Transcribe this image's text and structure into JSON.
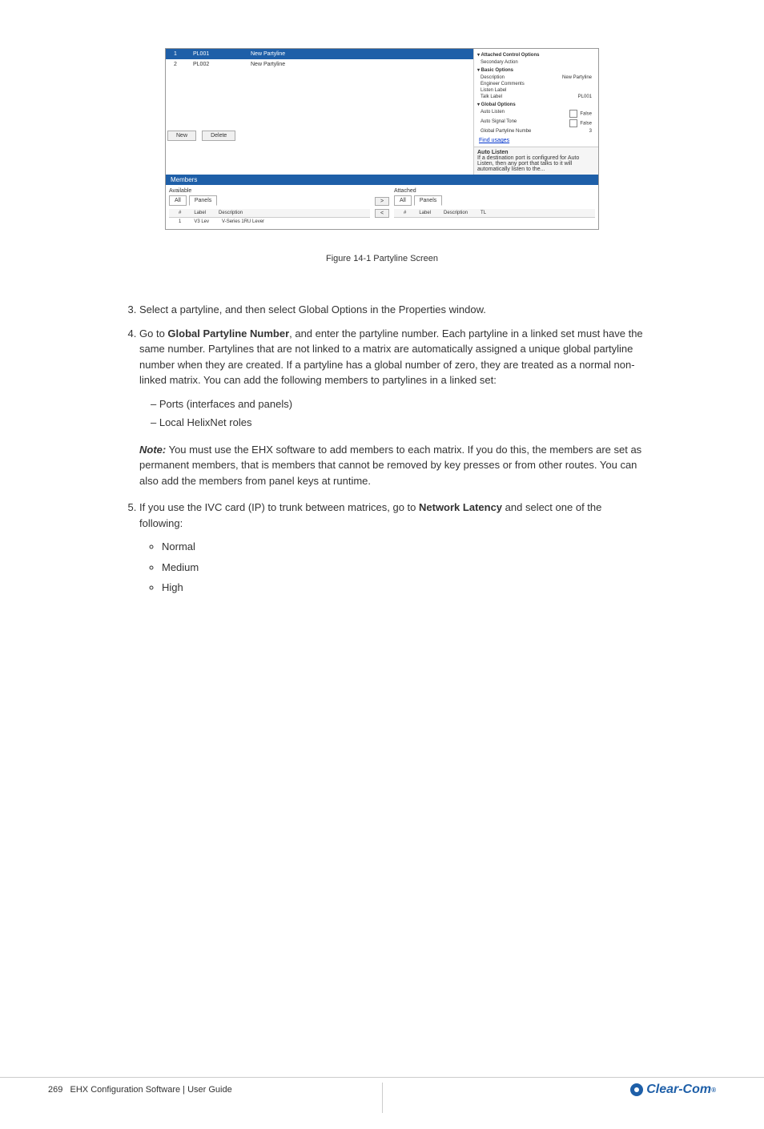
{
  "screenshot": {
    "grid": {
      "rows": [
        {
          "n": "1",
          "label": "PL001",
          "desc": "New Partyline",
          "selected": true
        },
        {
          "n": "2",
          "label": "PL002",
          "desc": "New Partyline",
          "selected": false
        }
      ],
      "btn_new": "New",
      "btn_delete": "Delete"
    },
    "props": {
      "groups": [
        {
          "name": "Attached Control Options",
          "items": [
            {
              "k": "Secondary Action",
              "v": ""
            }
          ]
        },
        {
          "name": "Basic Options",
          "items": [
            {
              "k": "Description",
              "v": "New Partyline"
            },
            {
              "k": "Engineer Comments",
              "v": ""
            },
            {
              "k": "Listen Label",
              "v": ""
            },
            {
              "k": "Talk Label",
              "v": "PL001"
            }
          ]
        },
        {
          "name": "Global Options",
          "items": [
            {
              "k": "Auto Listen",
              "v": "False",
              "cb": true
            },
            {
              "k": "Auto Signal Tone",
              "v": "False",
              "cb": true
            },
            {
              "k": "Global Partyline Numbe",
              "v": "3"
            }
          ]
        }
      ],
      "link": "Find usages",
      "help_title": "Auto Listen",
      "help_text": "If a destination port is configured for Auto Listen, then any port that talks to it will automatically listen to the..."
    },
    "members": {
      "title": "Members",
      "avail": "Available",
      "att": "Attached",
      "tab_all": "All",
      "tab_panels": "Panels",
      "col_n": "#",
      "col_label": "Label",
      "col_desc": "Description",
      "col_tl": "TL",
      "avail_rows": [
        {
          "n": "1",
          "label": "V3 Lev",
          "desc": "V-Series 1RU Lever"
        }
      ],
      "btn_right": ">",
      "btn_left": "<"
    }
  },
  "caption": "Figure 14-1 Partyline Screen",
  "steps": [
    {
      "n": "3",
      "text": "Select a partyline, and then select Global Options in the Properties window."
    },
    {
      "n": "4",
      "pre": "Go to ",
      "b": "Global Partyline Number",
      "post": ", and enter the partyline number. Each partyline in a linked set must have the same number. Partylines that are not linked to a matrix are automatically assigned a unique global partyline number when they are created. If a partyline has a global number of zero, they are treated as a normal non-linked matrix. You can add the following members to partylines in a linked set:"
    },
    {
      "n": "5",
      "pre": "If you use the IVC card (IP) to trunk between matrices, go to ",
      "b": "Network Latency",
      "post": " and select one of the following:"
    }
  ],
  "subitems": [
    "Ports (interfaces and panels)",
    "Local HelixNet roles"
  ],
  "note_label": "Note:",
  "note_text": "You must use the EHX software to add members to each matrix. If you do this, the members are set as permanent members, that is members that cannot be removed by key presses or from other routes. You can also add the members from panel keys at runtime.",
  "latency": [
    "Normal",
    "Medium",
    "High"
  ],
  "footer": {
    "page": "269",
    "doc": "EHX Configuration Software | User Guide",
    "brand": "Clear-Com"
  }
}
